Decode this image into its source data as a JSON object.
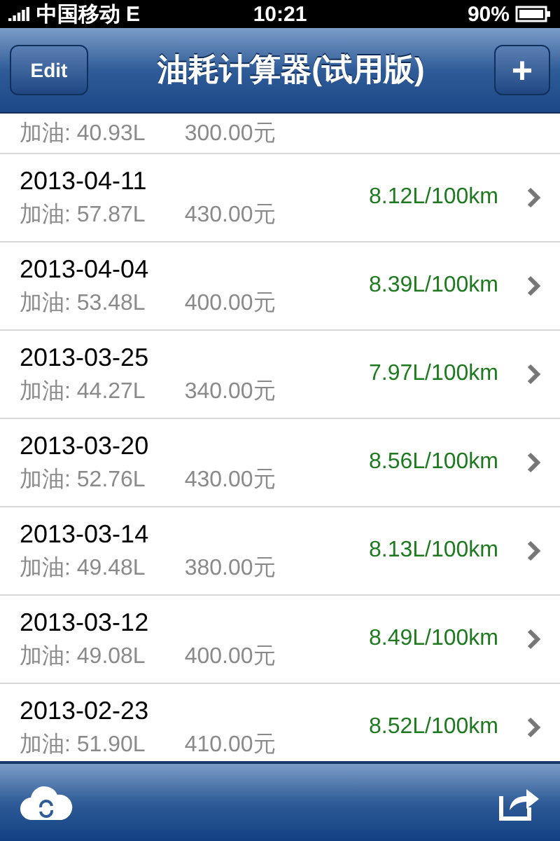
{
  "status_bar": {
    "carrier": "中国移动",
    "network": "E",
    "time": "10:21",
    "battery": "90%"
  },
  "nav_bar": {
    "left_button": "Edit",
    "title": "油耗计算器(试用版)",
    "right_button": "+"
  },
  "records": [
    {
      "kind": "partial",
      "fuel": "加油: 40.93L",
      "cost": "300.00元"
    },
    {
      "kind": "full",
      "date": "2013-04-11",
      "fuel": "加油: 57.87L",
      "cost": "430.00元",
      "consumption": "8.12L/100km"
    },
    {
      "kind": "full",
      "date": "2013-04-04",
      "fuel": "加油: 53.48L",
      "cost": "400.00元",
      "consumption": "8.39L/100km"
    },
    {
      "kind": "full",
      "date": "2013-03-25",
      "fuel": "加油: 44.27L",
      "cost": "340.00元",
      "consumption": "7.97L/100km"
    },
    {
      "kind": "full",
      "date": "2013-03-20",
      "fuel": "加油: 52.76L",
      "cost": "430.00元",
      "consumption": "8.56L/100km"
    },
    {
      "kind": "full",
      "date": "2013-03-14",
      "fuel": "加油: 49.48L",
      "cost": "380.00元",
      "consumption": "8.13L/100km"
    },
    {
      "kind": "full",
      "date": "2013-03-12",
      "fuel": "加油: 49.08L",
      "cost": "400.00元",
      "consumption": "8.49L/100km"
    },
    {
      "kind": "full",
      "date": "2013-02-23",
      "fuel": "加油: 51.90L",
      "cost": "410.00元",
      "consumption": "8.52L/100km"
    }
  ]
}
